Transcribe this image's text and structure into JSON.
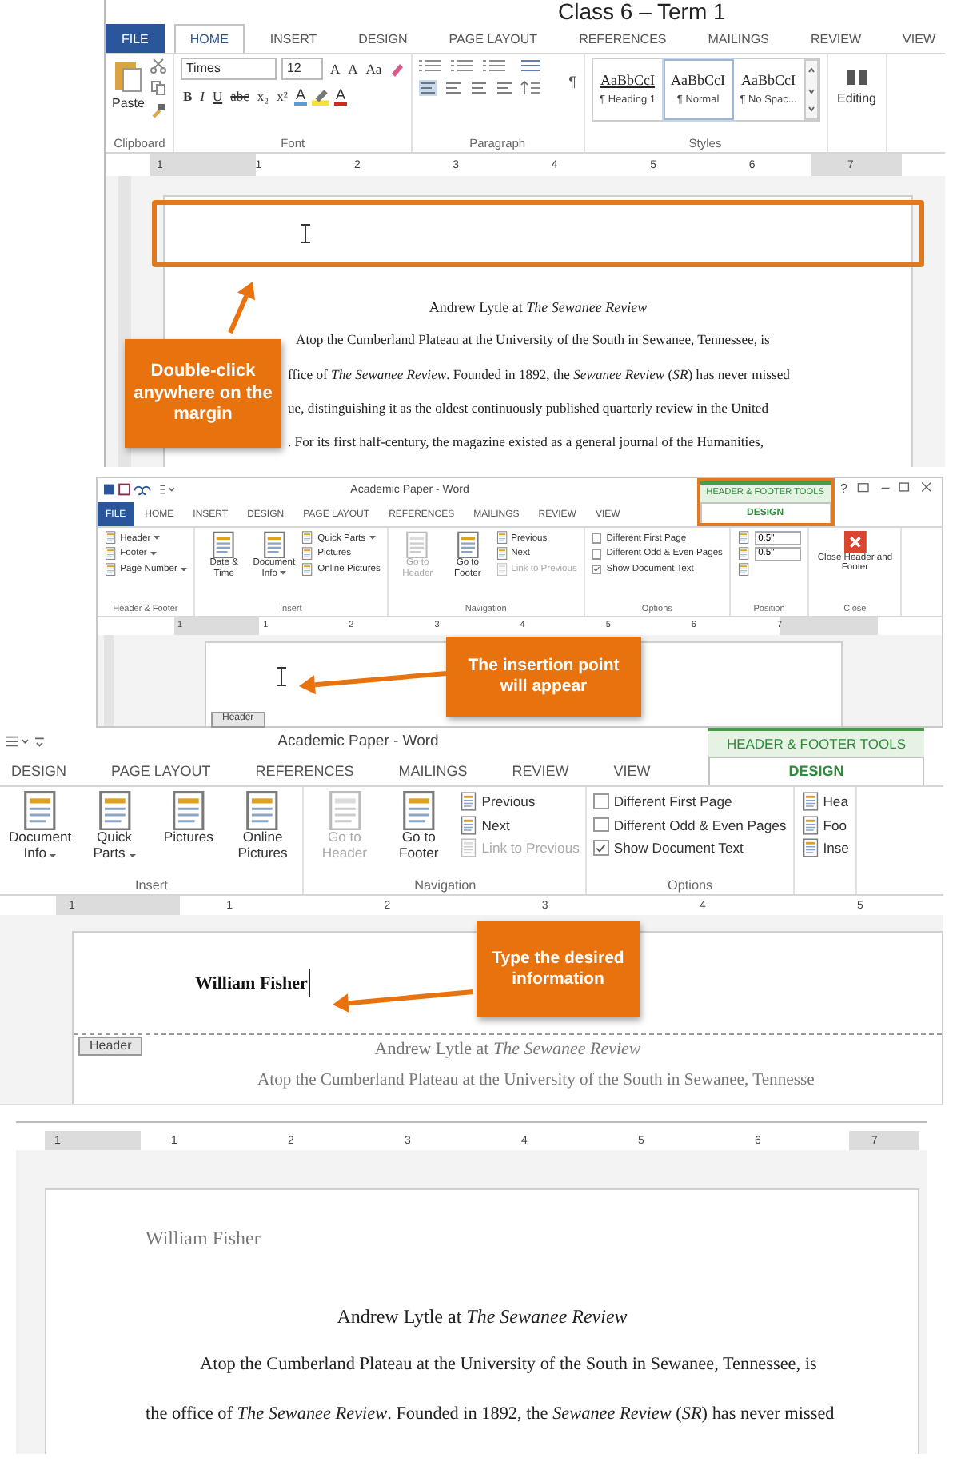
{
  "class_label": "Class 6 – Term 1",
  "step_1": {
    "tabs": [
      {
        "label": "FILE",
        "kind": "file",
        "selected": false
      },
      {
        "label": "HOME",
        "kind": "normal",
        "selected": true
      },
      {
        "label": "INSERT",
        "kind": "normal",
        "selected": false
      },
      {
        "label": "DESIGN",
        "kind": "normal",
        "selected": false
      },
      {
        "label": "PAGE LAYOUT",
        "kind": "normal",
        "selected": false
      },
      {
        "label": "REFERENCES",
        "kind": "normal",
        "selected": false
      },
      {
        "label": "MAILINGS",
        "kind": "normal",
        "selected": false
      },
      {
        "label": "REVIEW",
        "kind": "normal",
        "selected": false
      },
      {
        "label": "VIEW",
        "kind": "normal",
        "selected": false
      }
    ],
    "clipboard": {
      "paste": "Paste",
      "label": "Clipboard"
    },
    "font": {
      "name": "Times",
      "size": "12",
      "size_buttons": [
        "A",
        "A"
      ],
      "case": "Aa",
      "format_buttons": [
        "B",
        "I",
        "U",
        "abc",
        "x₂",
        "x²"
      ],
      "color_buttons": [
        "A",
        "A"
      ],
      "label": "Font"
    },
    "paragraph": {
      "marks": "¶",
      "label": "Paragraph"
    },
    "styles": {
      "items": [
        {
          "sample": "AaBbCcI",
          "name": "¶ Heading 1",
          "selected": false
        },
        {
          "sample": "AaBbCcI",
          "name": "¶ Normal",
          "selected": true
        },
        {
          "sample": "AaBbCcI",
          "name": "¶ No Spac...",
          "selected": false
        }
      ],
      "label": "Styles"
    },
    "editing": "Editing",
    "ruler": [
      "1",
      "1",
      "2",
      "3",
      "4",
      "5",
      "6",
      "7"
    ],
    "callout": "Double-click anywhere on the margin",
    "doc_title": "Andrew Lytle at *The Sewanee Review*",
    "doc_lines": [
      "Atop the Cumberland Plateau at the University of the South in Sewanee, Tennessee, is",
      "ffice of *The Sewanee Review*. Founded in 1892, the *Sewanee Review* (*SR*) has never missed",
      "ue, distinguishing it as the oldest continuously published quarterly review in the United",
      ". For its first half-century, the magazine existed as a general journal of the Humanities,"
    ]
  },
  "step_2": {
    "title": "Academic Paper - Word",
    "tools_label": "HEADER & FOOTER TOOLS",
    "help": "?",
    "tabs": [
      {
        "label": "FILE",
        "kind": "file",
        "selected": false
      },
      {
        "label": "HOME",
        "kind": "normal",
        "selected": false
      },
      {
        "label": "INSERT",
        "kind": "normal",
        "selected": false
      },
      {
        "label": "DESIGN",
        "kind": "normal",
        "selected": false
      },
      {
        "label": "PAGE LAYOUT",
        "kind": "normal",
        "selected": false
      },
      {
        "label": "REFERENCES",
        "kind": "normal",
        "selected": false
      },
      {
        "label": "MAILINGS",
        "kind": "normal",
        "selected": false
      },
      {
        "label": "REVIEW",
        "kind": "normal",
        "selected": false
      },
      {
        "label": "VIEW",
        "kind": "normal",
        "selected": false
      },
      {
        "label": "DESIGN",
        "kind": "contextual",
        "selected": true
      }
    ],
    "groups": [
      {
        "label": "Header & Footer",
        "sections": [
          {
            "kind": "list",
            "items": [
              {
                "text": "Header",
                "dropdown": true,
                "disabled": false
              },
              {
                "text": "Footer",
                "dropdown": true,
                "disabled": false
              },
              {
                "text": "Page Number",
                "dropdown": true,
                "disabled": false
              }
            ]
          }
        ]
      },
      {
        "label": "Insert",
        "sections": [
          {
            "kind": "big",
            "items": [
              {
                "text": "Date & Time",
                "dropdown": false,
                "disabled": false
              },
              {
                "text": "Document Info",
                "dropdown": true,
                "disabled": false
              }
            ]
          },
          {
            "kind": "list",
            "items": [
              {
                "text": "Quick Parts",
                "dropdown": true,
                "disabled": false
              },
              {
                "text": "Pictures",
                "dropdown": false,
                "disabled": false
              },
              {
                "text": "Online Pictures",
                "dropdown": false,
                "disabled": false
              }
            ]
          }
        ]
      },
      {
        "label": "Navigation",
        "sections": [
          {
            "kind": "big",
            "items": [
              {
                "text": "Go to Header",
                "dropdown": false,
                "disabled": true
              },
              {
                "text": "Go to Footer",
                "dropdown": false,
                "disabled": false
              }
            ]
          },
          {
            "kind": "list",
            "items": [
              {
                "text": "Previous",
                "dropdown": false,
                "disabled": false
              },
              {
                "text": "Next",
                "dropdown": false,
                "disabled": false
              },
              {
                "text": "Link to Previous",
                "dropdown": false,
                "disabled": true
              }
            ]
          }
        ]
      },
      {
        "label": "Options",
        "sections": [
          {
            "kind": "checks",
            "items": [
              {
                "text": "Different First Page",
                "checked": false
              },
              {
                "text": "Different Odd & Even Pages",
                "checked": false
              },
              {
                "text": "Show Document Text",
                "checked": true
              }
            ]
          }
        ]
      },
      {
        "label": "Position",
        "sections": [
          {
            "kind": "spinners",
            "items": [
              {
                "value": "0.5\""
              },
              {
                "value": "0.5\""
              }
            ]
          }
        ]
      },
      {
        "label": "Close",
        "sections": [
          {
            "kind": "close",
            "items": [
              {
                "text": "Close Header and Footer",
                "dropdown": false,
                "disabled": false
              }
            ]
          }
        ]
      }
    ],
    "ruler": [
      "1",
      "1",
      "2",
      "3",
      "4",
      "5",
      "6",
      "7"
    ],
    "callout": "The insertion point will appear",
    "header_tag": "Header"
  },
  "step_3": {
    "title": "Academic Paper - Word",
    "tools_label": "HEADER & FOOTER TOOLS",
    "tabs": [
      {
        "label": "DESIGN",
        "kind": "normal",
        "selected": false
      },
      {
        "label": "PAGE LAYOUT",
        "kind": "normal",
        "selected": false
      },
      {
        "label": "REFERENCES",
        "kind": "normal",
        "selected": false
      },
      {
        "label": "MAILINGS",
        "kind": "normal",
        "selected": false
      },
      {
        "label": "REVIEW",
        "kind": "normal",
        "selected": false
      },
      {
        "label": "VIEW",
        "kind": "normal",
        "selected": false
      },
      {
        "label": "DESIGN",
        "kind": "contextual",
        "selected": true
      }
    ],
    "groups": [
      {
        "label": "Insert",
        "sections": [
          {
            "kind": "big",
            "items": [
              {
                "text": "Document Info",
                "dropdown": true,
                "disabled": false
              },
              {
                "text": "Quick Parts",
                "dropdown": true,
                "disabled": false
              },
              {
                "text": "Pictures",
                "dropdown": false,
                "disabled": false
              },
              {
                "text": "Online Pictures",
                "dropdown": false,
                "disabled": false
              }
            ]
          }
        ]
      },
      {
        "label": "Navigation",
        "sections": [
          {
            "kind": "big",
            "items": [
              {
                "text": "Go to Header",
                "dropdown": false,
                "disabled": true
              },
              {
                "text": "Go to Footer",
                "dropdown": false,
                "disabled": false
              }
            ]
          },
          {
            "kind": "list",
            "items": [
              {
                "text": "Previous",
                "dropdown": false,
                "disabled": false
              },
              {
                "text": "Next",
                "dropdown": false,
                "disabled": false
              },
              {
                "text": "Link to Previous",
                "dropdown": false,
                "disabled": true
              }
            ]
          }
        ]
      },
      {
        "label": "Options",
        "sections": [
          {
            "kind": "checks",
            "items": [
              {
                "text": "Different First Page",
                "checked": false
              },
              {
                "text": "Different Odd & Even Pages",
                "checked": false
              },
              {
                "text": "Show Document Text",
                "checked": true
              }
            ]
          }
        ]
      },
      {
        "sections": [
          {
            "kind": "list",
            "items": [
              {
                "text": "Hea",
                "dropdown": false,
                "disabled": false
              },
              {
                "text": "Foo",
                "dropdown": false,
                "disabled": false
              },
              {
                "text": "Inse",
                "dropdown": false,
                "disabled": false
              }
            ]
          }
        ]
      }
    ],
    "ruler": [
      "1",
      "1",
      "2",
      "3",
      "4",
      "5"
    ],
    "header_text": "William Fisher",
    "callout": "Type the desired information",
    "header_tag": "Header",
    "doc_title": "Andrew Lytle at *The Sewanee Review*",
    "doc_line": "Atop the Cumberland Plateau at the University of the South in Sewanee, Tennesse"
  },
  "step_4": {
    "ruler": [
      "1",
      "1",
      "2",
      "3",
      "4",
      "5",
      "6",
      "7"
    ],
    "header_text": "William Fisher",
    "doc_title": "Andrew Lytle at *The Sewanee Review*",
    "doc_lines": [
      "Atop the Cumberland Plateau at the University of the South in Sewanee, Tennessee, is",
      "the office of *The Sewanee Review*. Founded in 1892, the *Sewanee Review* (*SR*) has never missed"
    ]
  }
}
